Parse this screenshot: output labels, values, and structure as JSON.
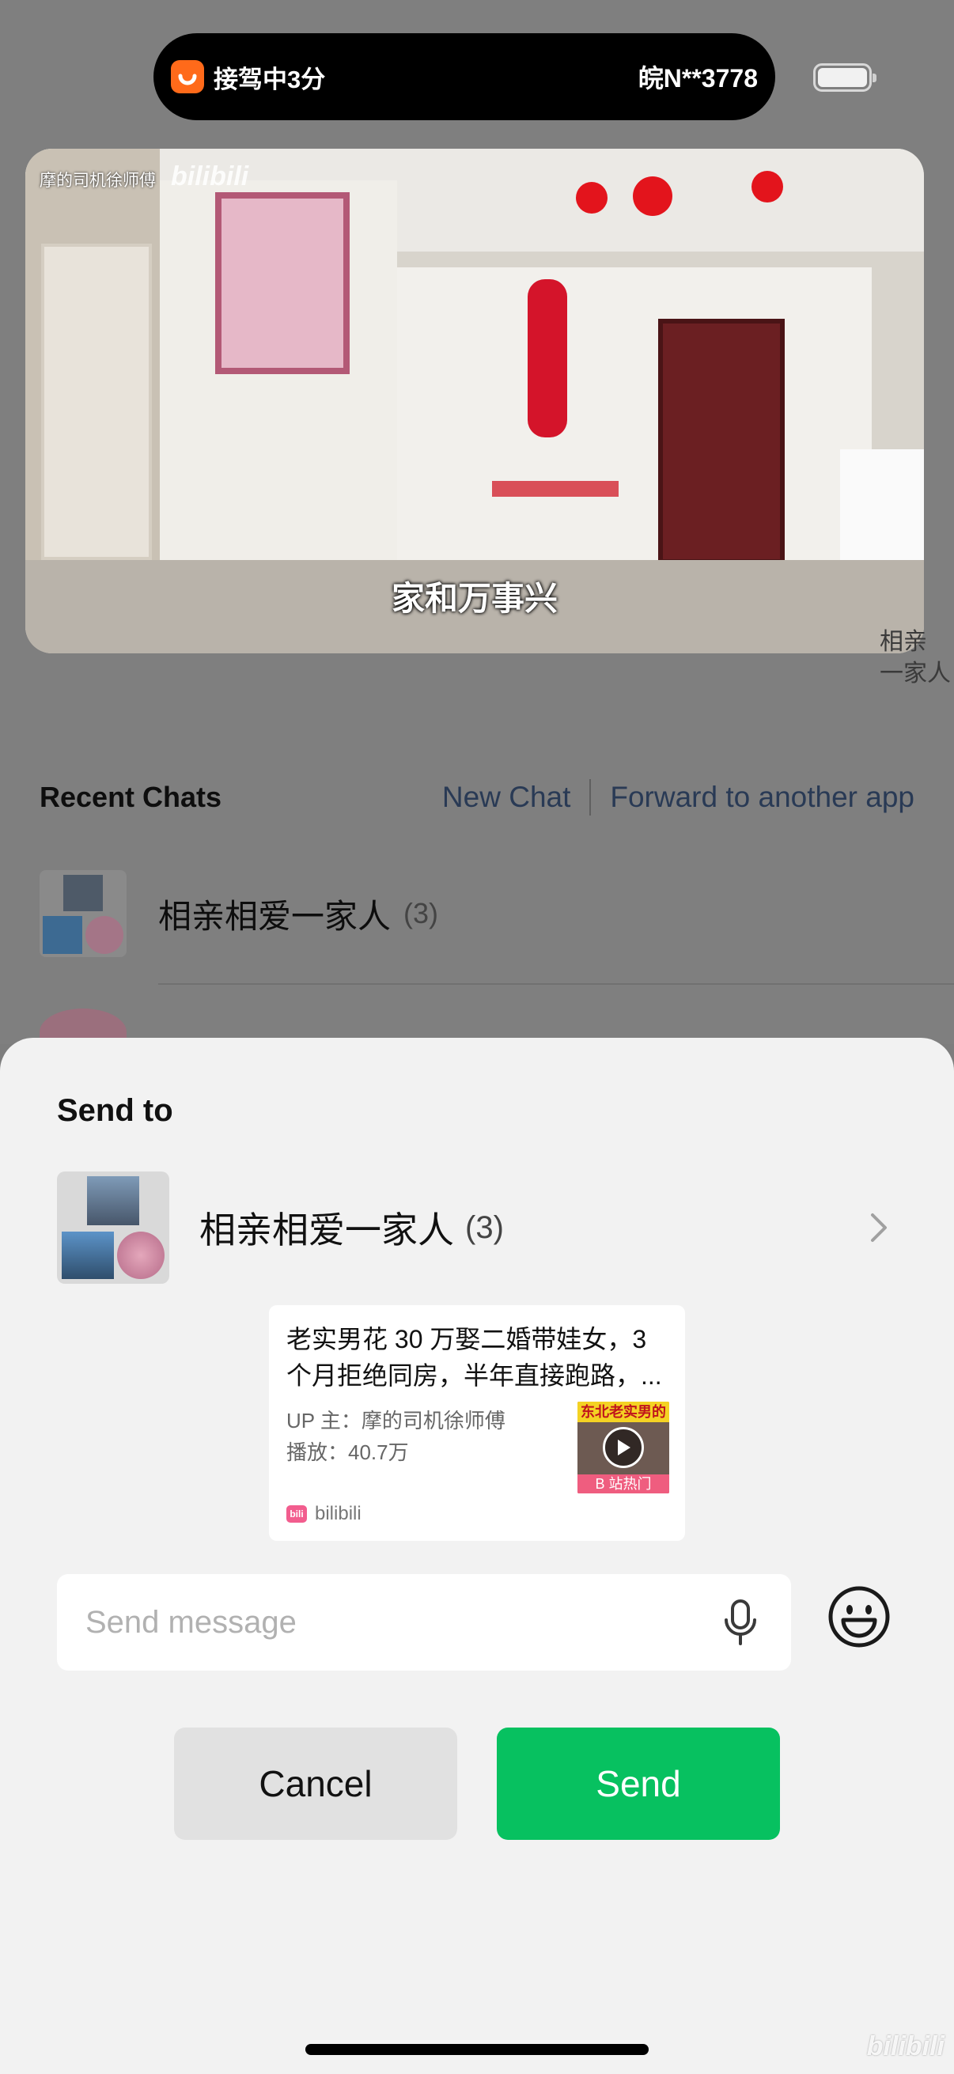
{
  "status_bar": {
    "ride_status": "接驾中3分",
    "plate_number": "皖N**3778"
  },
  "video_preview": {
    "uploader": "摩的司机徐师傅",
    "watermark": "bilibili",
    "caption": "家和万事兴"
  },
  "background_peek_text": "相亲\n一家人",
  "recent_chats": {
    "title": "Recent Chats",
    "new_chat": "New Chat",
    "forward": "Forward to another app",
    "items": [
      {
        "name": "相亲相爱一家人",
        "count": "(3)"
      }
    ]
  },
  "sheet": {
    "title": "Send to",
    "target": {
      "name": "相亲相爱一家人",
      "count": "(3)"
    },
    "card": {
      "title": "老实男花 30 万娶二婚带娃女，3 个月拒绝同房，半年直接跑路，...",
      "uploader": "UP 主：摩的司机徐师傅",
      "plays": "播放：40.7万",
      "thumb_top": "东北老实男的",
      "thumb_bottom": "B 站热门",
      "source": "bilibili",
      "source_logo": "bili"
    },
    "input": {
      "placeholder": "Send message",
      "value": ""
    },
    "cancel_label": "Cancel",
    "send_label": "Send"
  },
  "corner_watermark": "bilibili",
  "colors": {
    "send_green": "#07c160",
    "didi_orange": "#ff6a1a",
    "link_blue": "#293a55"
  },
  "icons": [
    "didi-icon",
    "battery-icon",
    "chevron-right-icon",
    "mic-icon",
    "emoji-icon",
    "play-icon",
    "bilibili-logo-icon"
  ]
}
